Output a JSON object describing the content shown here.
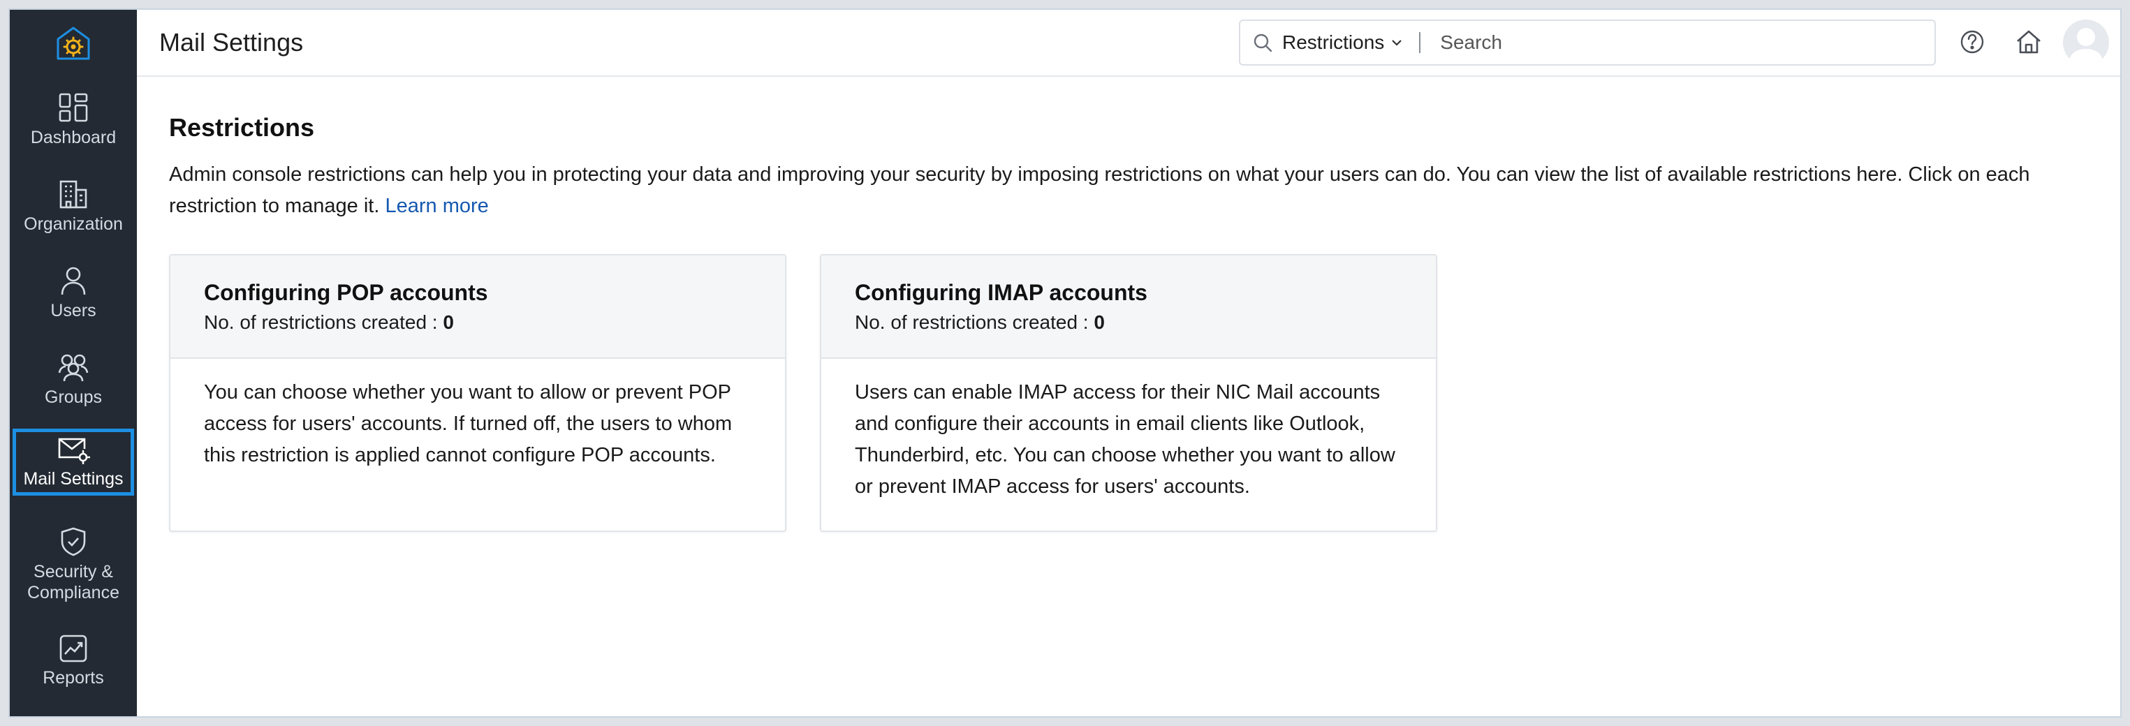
{
  "app": {
    "page_title": "Mail Settings"
  },
  "sidebar": {
    "items": [
      {
        "label": "Dashboard",
        "icon": "dashboard-icon"
      },
      {
        "label": "Organization",
        "icon": "building-icon"
      },
      {
        "label": "Users",
        "icon": "user-icon"
      },
      {
        "label": "Groups",
        "icon": "groups-icon"
      },
      {
        "label": "Mail Settings",
        "icon": "mail-settings-icon",
        "active": true
      },
      {
        "label": "Security &",
        "label2": "Compliance",
        "icon": "shield-icon"
      },
      {
        "label": "Reports",
        "icon": "reports-icon"
      }
    ],
    "active_color": "#1d8fe3",
    "bg_color": "#232a33"
  },
  "header": {
    "search_scope": "Restrictions",
    "search_placeholder": "Search"
  },
  "main": {
    "section_title": "Restrictions",
    "description": "Admin console restrictions can help you in protecting your data and improving your security by imposing restrictions on what your users can do. You can view the list of available restrictions here. Click on each restriction to manage it.",
    "learn_more": "Learn more",
    "cards": [
      {
        "title": "Configuring POP accounts",
        "count_label": "No. of restrictions created :",
        "count": "0",
        "body": "You can choose whether you want to allow or prevent POP access for users' accounts. If turned off, the users to whom this restriction is applied cannot configure POP accounts."
      },
      {
        "title": "Configuring IMAP accounts",
        "count_label": "No. of restrictions created :",
        "count": "0",
        "body": "Users can enable IMAP access for their NIC Mail accounts and configure their accounts in email clients like Outlook, Thunderbird, etc. You can choose whether you want to allow or prevent IMAP access for users' accounts."
      }
    ]
  },
  "link_color": "#1558b0"
}
